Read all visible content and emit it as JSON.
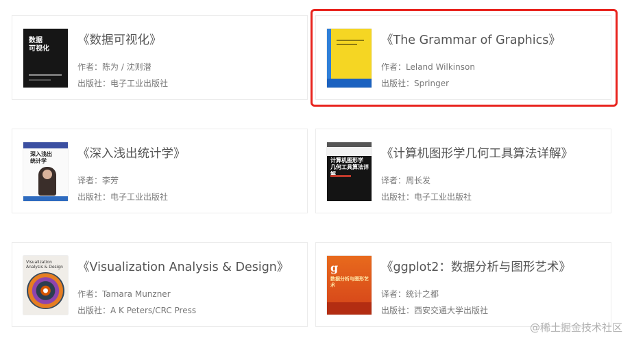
{
  "books": [
    {
      "title": "《数据可视化》",
      "line1": "作者：陈为 / 沈则潜",
      "line2": "出版社：电子工业出版社",
      "cover_text": "数据\n可视化",
      "icon": "book-cover-icon"
    },
    {
      "title": "《The Grammar of Graphics》",
      "line1": "作者：Leland Wilkinson",
      "line2": "出版社：Springer",
      "icon": "book-cover-icon",
      "highlighted": true
    },
    {
      "title": "《深入浅出统计学》",
      "line1": "译者：李芳",
      "line2": "出版社：电子工业出版社",
      "cover_text": "深入浅出\n统计学",
      "icon": "book-cover-icon"
    },
    {
      "title": "《计算机图形学几何工具算法详解》",
      "line1": "译者：周长发",
      "line2": "出版社：电子工业出版社",
      "cover_text": "计算机图形学\n几何工具算法详解",
      "icon": "book-cover-icon"
    },
    {
      "title": "《Visualization Analysis & Design》",
      "line1": "作者：Tamara Munzner",
      "line2": "出版社：A K Peters/CRC Press",
      "cover_text": "Visualization\nAnalysis & Design",
      "icon": "book-cover-icon"
    },
    {
      "title": "《ggplot2：数据分析与图形艺术》",
      "line1": "译者：统计之都",
      "line2": "出版社：西安交通大学出版社",
      "cover_text": "数据分析与图形艺术",
      "cover_letter": "g",
      "icon": "book-cover-icon"
    }
  ],
  "watermark": "@稀土掘金技术社区",
  "colors": {
    "highlight": "#e8231d",
    "card_border": "#ececec",
    "title_text": "#555555",
    "meta_text": "#777777"
  }
}
